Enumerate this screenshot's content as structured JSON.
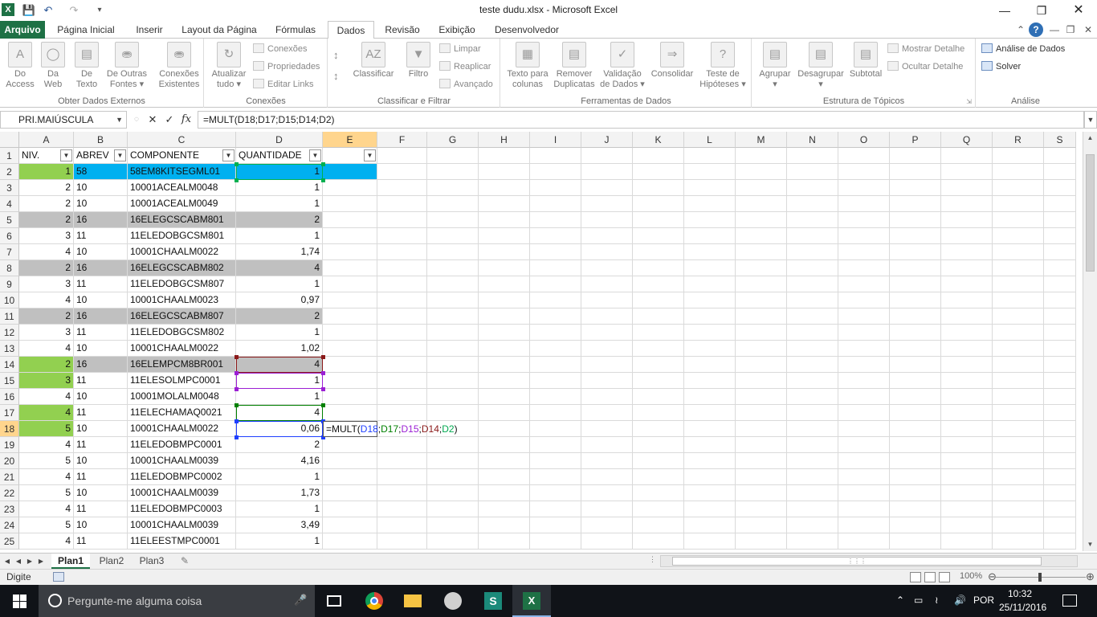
{
  "window": {
    "title": "teste dudu.xlsx  -  Microsoft Excel",
    "app_icon": "X"
  },
  "icons": {
    "app": "excel-icon",
    "save": "save-icon",
    "undo": "undo-icon",
    "redo": "redo-icon",
    "minimize": "minimize-icon",
    "restore": "restore-icon",
    "close": "close-icon",
    "help": "help-icon",
    "cancel": "cancel-x-icon",
    "enter": "check-icon",
    "fx": "fx-icon"
  },
  "tabs": [
    {
      "label": "Arquivo"
    },
    {
      "label": "Página Inicial"
    },
    {
      "label": "Inserir"
    },
    {
      "label": "Layout da Página"
    },
    {
      "label": "Fórmulas"
    },
    {
      "label": "Dados"
    },
    {
      "label": "Revisão"
    },
    {
      "label": "Exibição"
    },
    {
      "label": "Desenvolvedor"
    }
  ],
  "ribbon": {
    "groups": {
      "external": "Obter Dados Externos",
      "connections": "Conexões",
      "sort": "Classificar e Filtrar",
      "tools": "Ferramentas de Dados",
      "outline": "Estrutura de Tópicos",
      "analysis": "Análise"
    },
    "buttons": {
      "access": [
        "Do",
        "Access"
      ],
      "web": [
        "Da",
        "Web"
      ],
      "text": [
        "De",
        "Texto"
      ],
      "other": [
        "De Outras",
        "Fontes ▾"
      ],
      "existing": [
        "Conexões",
        "Existentes"
      ],
      "refresh": [
        "Atualizar",
        "tudo ▾"
      ],
      "conn": "Conexões",
      "props": "Propriedades",
      "links": "Editar Links",
      "sort": "Classificar",
      "filter": "Filtro",
      "clear": "Limpar",
      "reapply": "Reaplicar",
      "advanced": "Avançado",
      "t2c": [
        "Texto para",
        "colunas"
      ],
      "dups": [
        "Remover",
        "Duplicatas"
      ],
      "valid": [
        "Validação",
        "de Dados ▾"
      ],
      "consol": "Consolidar",
      "whatif": [
        "Teste de",
        "Hipóteses ▾"
      ],
      "group": [
        "Agrupar",
        "▾"
      ],
      "ungroup": [
        "Desagrupar",
        "▾"
      ],
      "subtotal": "Subtotal",
      "show": "Mostrar Detalhe",
      "hide": "Ocultar Detalhe",
      "analysis": "Análise de Dados",
      "solver": "Solver"
    }
  },
  "formula_bar": {
    "name_box": "PRI.MAIÚSCULA",
    "formula": "=MULT(D18;D17;D15;D14;D2)",
    "fx": "fx"
  },
  "columns": [
    "A",
    "B",
    "C",
    "D",
    "E",
    "F",
    "G",
    "H",
    "I",
    "J",
    "K",
    "L",
    "M",
    "N",
    "O",
    "P",
    "Q",
    "R",
    "S"
  ],
  "header_row": [
    "NIV.",
    "ABREV",
    "COMPONENTE",
    "QUANTIDADE",
    ""
  ],
  "rows": [
    {
      "n": 2,
      "a": "1",
      "b": "58",
      "c": "58EM8KITSEGML01",
      "d": "1"
    },
    {
      "n": 3,
      "a": "2",
      "b": "10",
      "c": "10001ACEALM0048",
      "d": "1"
    },
    {
      "n": 4,
      "a": "2",
      "b": "10",
      "c": "10001ACEALM0049",
      "d": "1"
    },
    {
      "n": 5,
      "a": "2",
      "b": "16",
      "c": "16ELEGCSCABM801",
      "d": "2"
    },
    {
      "n": 6,
      "a": "3",
      "b": "11",
      "c": "11ELEDOBGCSM801",
      "d": "1"
    },
    {
      "n": 7,
      "a": "4",
      "b": "10",
      "c": "10001CHAALM0022",
      "d": "1,74"
    },
    {
      "n": 8,
      "a": "2",
      "b": "16",
      "c": "16ELEGCSCABM802",
      "d": "4"
    },
    {
      "n": 9,
      "a": "3",
      "b": "11",
      "c": "11ELEDOBGCSM807",
      "d": "1"
    },
    {
      "n": 10,
      "a": "4",
      "b": "10",
      "c": "10001CHAALM0023",
      "d": "0,97"
    },
    {
      "n": 11,
      "a": "2",
      "b": "16",
      "c": "16ELEGCSCABM807",
      "d": "2"
    },
    {
      "n": 12,
      "a": "3",
      "b": "11",
      "c": "11ELEDOBGCSM802",
      "d": "1"
    },
    {
      "n": 13,
      "a": "4",
      "b": "10",
      "c": "10001CHAALM0022",
      "d": "1,02"
    },
    {
      "n": 14,
      "a": "2",
      "b": "16",
      "c": "16ELEMPCM8BR001",
      "d": "4"
    },
    {
      "n": 15,
      "a": "3",
      "b": "11",
      "c": "11ELESOLMPC0001",
      "d": "1"
    },
    {
      "n": 16,
      "a": "4",
      "b": "10",
      "c": "10001MOLALM0048",
      "d": "1"
    },
    {
      "n": 17,
      "a": "4",
      "b": "11",
      "c": "11ELECHAMAQ0021",
      "d": "4"
    },
    {
      "n": 18,
      "a": "5",
      "b": "10",
      "c": "10001CHAALM0022",
      "d": "0,06"
    },
    {
      "n": 19,
      "a": "4",
      "b": "11",
      "c": "11ELEDOBMPC0001",
      "d": "2"
    },
    {
      "n": 20,
      "a": "5",
      "b": "10",
      "c": "10001CHAALM0039",
      "d": "4,16"
    },
    {
      "n": 21,
      "a": "4",
      "b": "11",
      "c": "11ELEDOBMPC0002",
      "d": "1"
    },
    {
      "n": 22,
      "a": "5",
      "b": "10",
      "c": "10001CHAALM0039",
      "d": "1,73"
    },
    {
      "n": 23,
      "a": "4",
      "b": "11",
      "c": "11ELEDOBMPC0003",
      "d": "1"
    },
    {
      "n": 24,
      "a": "5",
      "b": "10",
      "c": "10001CHAALM0039",
      "d": "3,49"
    },
    {
      "n": 25,
      "a": "4",
      "b": "11",
      "c": "11ELEESTMPC0001",
      "d": "1"
    }
  ],
  "edit_formula": {
    "prefix": "=MULT(",
    "r1": "D18",
    "r2": "D17",
    "r3": "D15",
    "r4": "D14",
    "r5": "D2",
    "sep": ";",
    "suffix": ")"
  },
  "fill_colors": {
    "green": "#92d050",
    "blue": "#00b0f0",
    "gray": "#c0c0c0"
  },
  "sheets": [
    "Plan1",
    "Plan2",
    "Plan3"
  ],
  "status": {
    "mode": "Digite",
    "zoom": "100%"
  },
  "taskbar": {
    "search_placeholder": "Pergunte-me alguma coisa",
    "lang": "POR",
    "time": "10:32",
    "date": "25/11/2016"
  }
}
